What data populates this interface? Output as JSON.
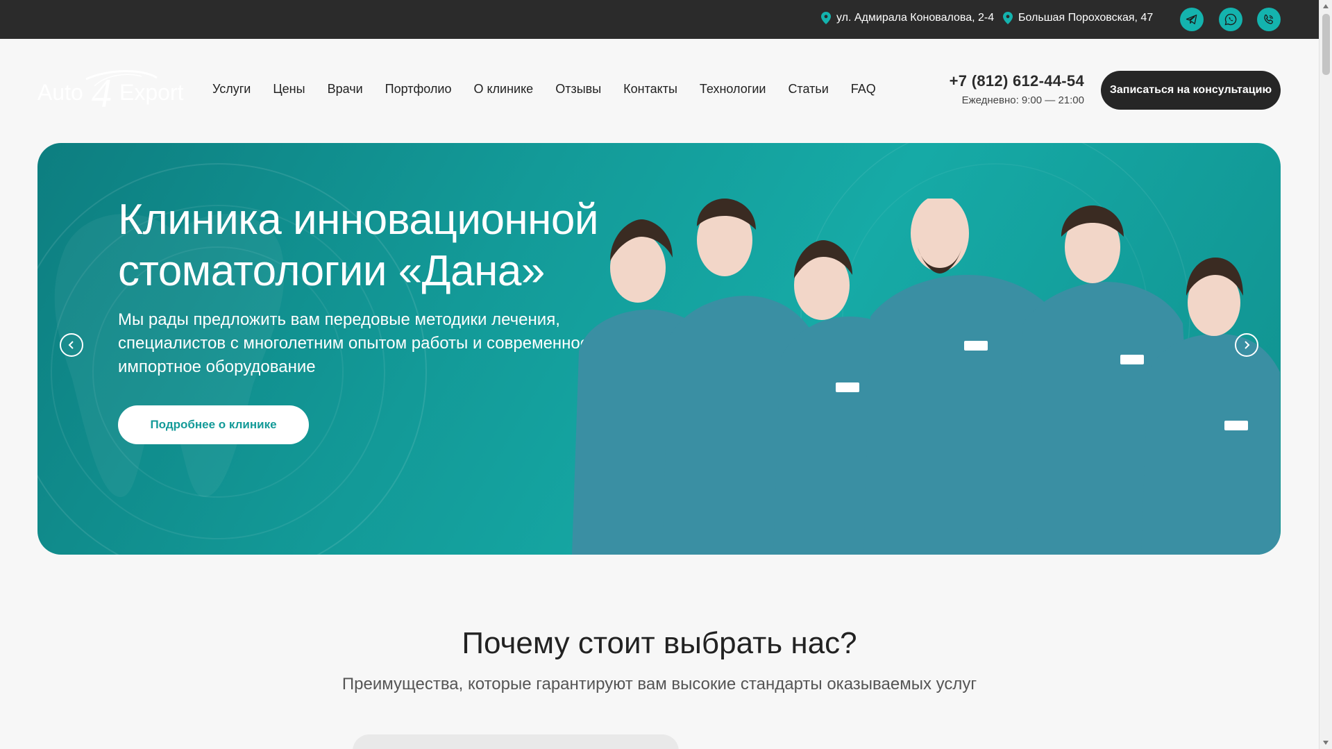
{
  "topbar": {
    "addresses": [
      "ул. Адмирала Коновалова, 2-4",
      "Большая Пороховская, 47"
    ],
    "socials": [
      "telegram-icon",
      "whatsapp-icon",
      "viber-icon"
    ],
    "accent": "#14b3ae"
  },
  "header": {
    "logo": {
      "word1": "Auto",
      "digit": "4",
      "word2": "Export"
    },
    "nav": [
      "Услуги",
      "Цены",
      "Врачи",
      "Портфолио",
      "О клинике",
      "Отзывы",
      "Контакты",
      "Технологии",
      "Статьи",
      "FAQ"
    ],
    "phone": "+7 (812) 612-44-54",
    "hours": "Ежедневно: 9:00 — 21:00",
    "cta": "Записаться на консультацию"
  },
  "hero": {
    "title_line1": "Клиника инновационной",
    "title_line2": "стоматологии «Дана»",
    "text": "Мы рады предложить вам передовые методики лечения, специалистов с многолетним опытом работы и современное импортное оборудование",
    "button": "Подробнее о клинике",
    "prev_icon": "chevron-left-icon",
    "next_icon": "chevron-right-icon",
    "bg_color": "#139a98",
    "uniform_color": "#3a8fa3"
  },
  "why": {
    "title": "Почему стоит выбрать нас?",
    "subtitle": "Преимущества, которые гарантируют вам высокие стандарты оказываемых услуг"
  }
}
